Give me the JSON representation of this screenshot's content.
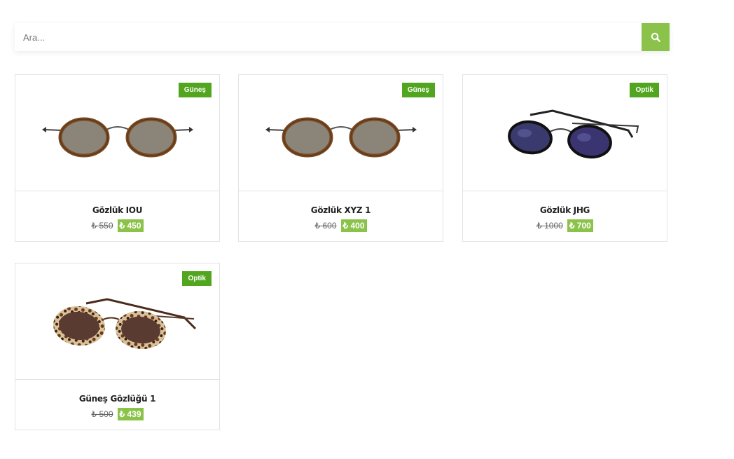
{
  "search": {
    "placeholder": "Ara..."
  },
  "icons": {
    "search": "search-icon"
  },
  "colors": {
    "accent": "#8bc34a",
    "badge": "#52a51e"
  },
  "products": [
    {
      "badge": "Güneş",
      "name": "Gözlük IOU",
      "old_price": "₺ 550",
      "new_price": "₺ 450"
    },
    {
      "badge": "Güneş",
      "name": "Gözlük XYZ 1",
      "old_price": "₺ 600",
      "new_price": "₺ 400"
    },
    {
      "badge": "Optik",
      "name": "Gözlük JHG",
      "old_price": "₺ 1000",
      "new_price": "₺ 700"
    },
    {
      "badge": "Optik",
      "name": "Güneş Gözlüğü 1",
      "old_price": "₺ 500",
      "new_price": "₺ 439"
    }
  ]
}
